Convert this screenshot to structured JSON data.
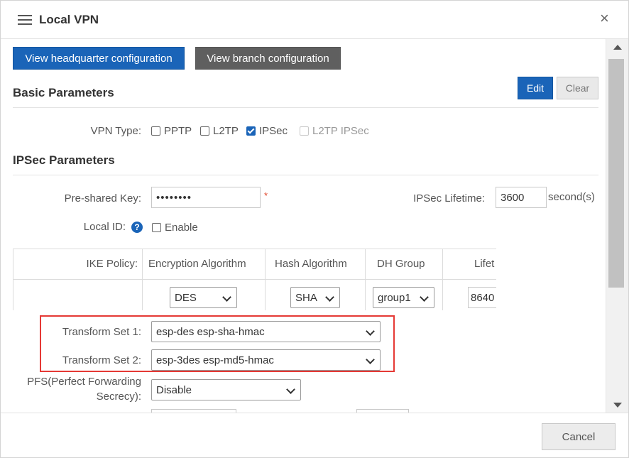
{
  "dialog": {
    "title": "Local VPN",
    "close_glyph": "×",
    "cancel_label": "Cancel"
  },
  "toolbar": {
    "headquarter_label": "View headquarter configuration",
    "branch_label": "View branch configuration"
  },
  "basic": {
    "section_title": "Basic Parameters",
    "edit_label": "Edit",
    "clear_label": "Clear",
    "vpn_type_label": "VPN Type:",
    "vpn_types": [
      {
        "label": "PPTP",
        "checked": false,
        "disabled": false
      },
      {
        "label": "L2TP",
        "checked": false,
        "disabled": false
      },
      {
        "label": "IPSec",
        "checked": true,
        "disabled": false
      },
      {
        "label": "L2TP IPSec",
        "checked": false,
        "disabled": true
      }
    ]
  },
  "ipsec": {
    "section_title": "IPSec Parameters",
    "psk_label": "Pre-shared Key:",
    "psk_value": "••••••••",
    "required_mark": "*",
    "lifetime_label": "IPSec Lifetime:",
    "lifetime_value": "3600",
    "lifetime_unit": "second(s)",
    "local_id_label": "Local ID:",
    "help_glyph": "?",
    "enable_label": "Enable",
    "enable_checked": false
  },
  "ike_table": {
    "headers": [
      "IKE Policy:",
      "Encryption Algorithm",
      "Hash Algorithm",
      "DH Group",
      "Lifet"
    ],
    "row": {
      "encryption": "DES",
      "hash": "SHA",
      "dh_group": "group1",
      "lifetime": "8640"
    }
  },
  "transform": {
    "set1_label": "Transform Set 1:",
    "set1_value": "esp-des esp-sha-hmac",
    "set2_label": "Transform Set 2:",
    "set2_value": "esp-3des esp-md5-hmac",
    "highlight_color": "#e53935"
  },
  "pfs": {
    "label_line1": "PFS(Perfect Forwarding",
    "label_line2": "Secrecy):",
    "value": "Disable"
  },
  "colors": {
    "primary": "#1a64b8",
    "secondary_button": "#5f5f5f"
  }
}
